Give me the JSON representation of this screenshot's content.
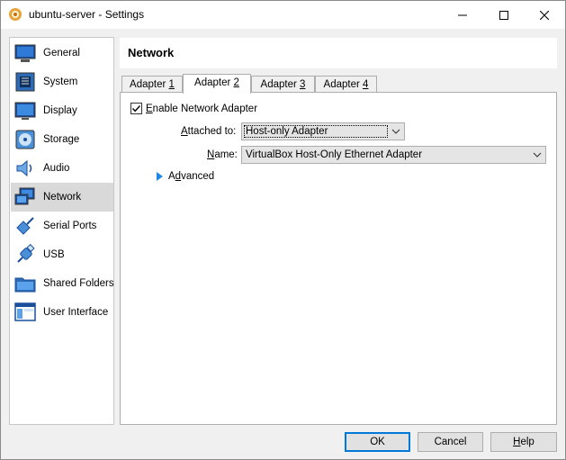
{
  "window": {
    "title": "ubuntu-server - Settings"
  },
  "sidebar": {
    "items": [
      {
        "label": "General",
        "icon": "general-icon"
      },
      {
        "label": "System",
        "icon": "system-icon"
      },
      {
        "label": "Display",
        "icon": "display-icon"
      },
      {
        "label": "Storage",
        "icon": "storage-icon"
      },
      {
        "label": "Audio",
        "icon": "audio-icon"
      },
      {
        "label": "Network",
        "icon": "network-icon",
        "selected": true
      },
      {
        "label": "Serial Ports",
        "icon": "serial-ports-icon"
      },
      {
        "label": "USB",
        "icon": "usb-icon"
      },
      {
        "label": "Shared Folders",
        "icon": "shared-folders-icon"
      },
      {
        "label": "User Interface",
        "icon": "user-interface-icon"
      }
    ]
  },
  "header": {
    "title": "Network"
  },
  "tabs": [
    {
      "pre": "Adapter ",
      "key": "1"
    },
    {
      "pre": "Adapter ",
      "key": "2",
      "active": true
    },
    {
      "pre": "Adapter ",
      "key": "3"
    },
    {
      "pre": "Adapter ",
      "key": "4"
    }
  ],
  "adapter": {
    "enable_pre": "",
    "enable_key": "E",
    "enable_post": "nable Network Adapter",
    "enabled": true,
    "attached_key": "A",
    "attached_post": "ttached to:",
    "attached_value": "Host-only Adapter",
    "name_key": "N",
    "name_post": "ame:",
    "name_value": "VirtualBox Host-Only Ethernet Adapter",
    "advanced_pre": "A",
    "advanced_key": "d",
    "advanced_post": "vanced"
  },
  "buttons": {
    "ok": "OK",
    "cancel": "Cancel",
    "help_key": "H",
    "help_post": "elp"
  },
  "colors": {
    "accent": "#0078d7",
    "selected_bg": "#d9d9d9"
  }
}
